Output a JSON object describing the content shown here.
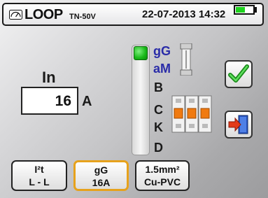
{
  "header": {
    "title": "LOOP",
    "subtitle": "TN-50V",
    "datetime": "22-07-2013 14:32",
    "battery_level": 0.5,
    "battery_color": "#1ed21e",
    "icon": "meter-icon"
  },
  "in_setting": {
    "label": "In",
    "value": "16",
    "unit": "A"
  },
  "curves": {
    "items": [
      "gG",
      "aM",
      "B",
      "C",
      "K",
      "D"
    ],
    "selected": "gG",
    "selected_color": "#2a2ca8"
  },
  "side_buttons": {
    "confirm_icon": "check-icon",
    "exit_icon": "exit-icon"
  },
  "bottom_buttons": [
    {
      "line1": "I²t",
      "line2": "L - L"
    },
    {
      "line1": "gG",
      "line2": "16A",
      "active": true,
      "accent": "#e7a21c"
    },
    {
      "line1": "1.5mm²",
      "line2": "Cu-PVC"
    }
  ]
}
